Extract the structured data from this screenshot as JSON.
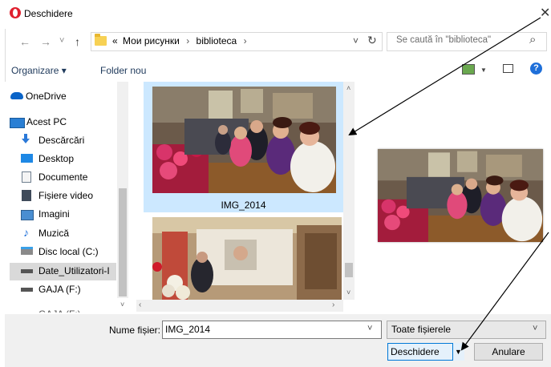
{
  "window": {
    "title": "Deschidere",
    "close_glyph": "✕"
  },
  "nav": {
    "back_glyph": "←",
    "forward_glyph": "→",
    "recent_glyph": "˅",
    "up_glyph": "↑",
    "breadcrumb": [
      "«",
      "Мои рисунки",
      "›",
      "biblioteca",
      "›"
    ],
    "dropdown_glyph": "˅",
    "refresh_glyph": "↻",
    "search_placeholder": "Se caută în \"biblioteca\"",
    "search_glyph": "⌕"
  },
  "toolbar": {
    "organize": "Organizare ▾",
    "new_folder": "Folder nou",
    "help": "?"
  },
  "sidebar": {
    "items": [
      {
        "label": "OneDrive",
        "icon": "cloud-icon",
        "color": "#0a64c8"
      },
      {
        "label": "Acest PC",
        "icon": "pc-icon",
        "color": "#2a7fd4"
      },
      {
        "label": "Descărcări",
        "icon": "download-icon",
        "color": "#2b79d8"
      },
      {
        "label": "Desktop",
        "icon": "desktop-icon",
        "color": "#1e88e5"
      },
      {
        "label": "Documente",
        "icon": "document-icon",
        "color": "#6f7f8f"
      },
      {
        "label": "Fișiere video",
        "icon": "video-icon",
        "color": "#3f4b5a"
      },
      {
        "label": "Imagini",
        "icon": "image-icon",
        "color": "#4a8ed1"
      },
      {
        "label": "Muzică",
        "icon": "music-icon",
        "color": "#1e6fd9"
      },
      {
        "label": "Disc local (C:)",
        "icon": "drive-icon",
        "color": "#8a8a8a"
      },
      {
        "label": "Date_Utilizatori-I",
        "icon": "drive-icon",
        "color": "#555555"
      },
      {
        "label": "GAJA (F:)",
        "icon": "drive-icon",
        "color": "#555555"
      },
      {
        "label": "GAJA (F:)",
        "icon": "drive-icon",
        "color": "#555555"
      }
    ]
  },
  "files": [
    {
      "name": "IMG_2014",
      "selected": true
    },
    {
      "name": "",
      "selected": false
    }
  ],
  "footer": {
    "filename_label": "Nume fișier:",
    "filename_value": "IMG_2014",
    "filetype_value": "Toate fișierele",
    "open_label": "Deschidere",
    "cancel_label": "Anulare"
  },
  "colors": {
    "selection": "#cce8ff",
    "accent": "#0078d7",
    "opera_red": "#e0202f"
  }
}
